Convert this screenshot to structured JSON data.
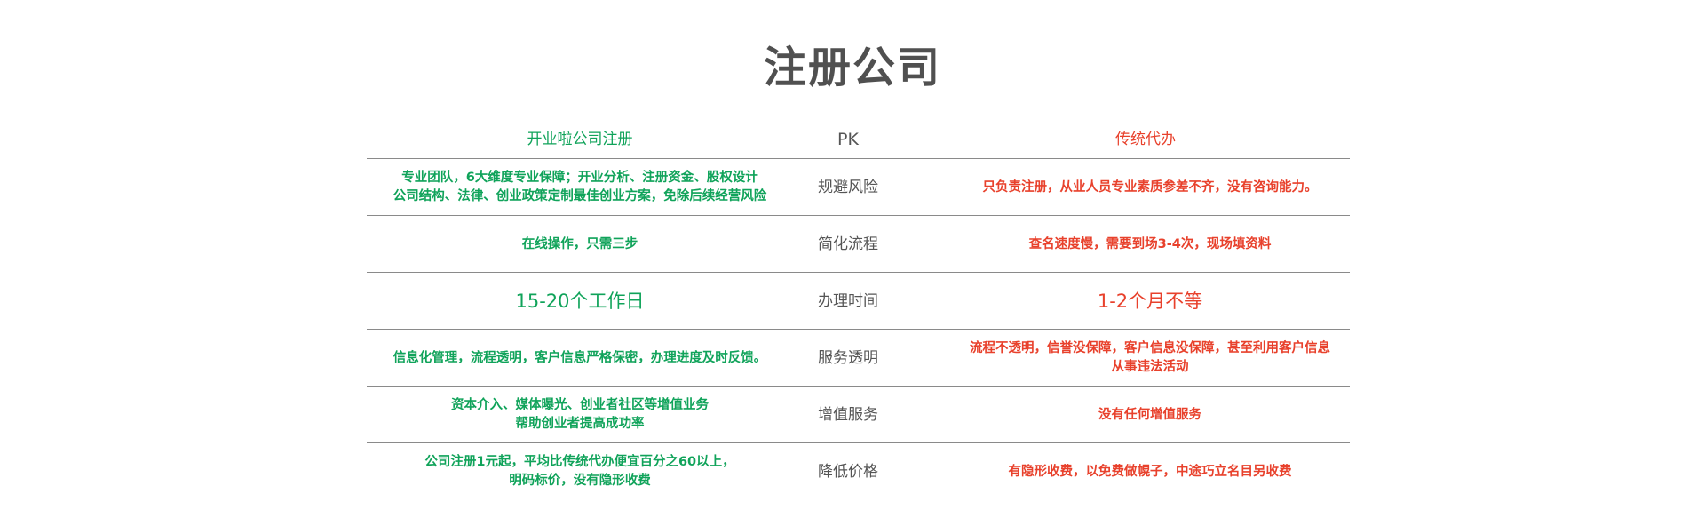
{
  "title": "注册公司",
  "header": {
    "left": "开业啦公司注册",
    "mid": "PK",
    "right": "传统代办"
  },
  "rows": [
    {
      "left": "专业团队，6大维度专业保障；开业分析、注册资金、股权设计\n公司结构、法律、创业政策定制最佳创业方案，免除后续经营风险",
      "mid": "规避风险",
      "right": "只负责注册，从业人员专业素质参差不齐，没有咨询能力。"
    },
    {
      "left": "在线操作，只需三步",
      "mid": "简化流程",
      "right": "查名速度慢，需要到场3-4次，现场填资料"
    },
    {
      "left": "15-20个工作日",
      "mid": "办理时间",
      "right": "1-2个月不等"
    },
    {
      "left": "信息化管理，流程透明，客户信息严格保密，办理进度及时反馈。",
      "mid": "服务透明",
      "right": "流程不透明，信誉没保障，客户信息没保障，甚至利用客户信息\n从事违法活动"
    },
    {
      "left": "资本介入、媒体曝光、创业者社区等增值业务\n帮助创业者提高成功率",
      "mid": "增值服务",
      "right": "没有任何增值服务"
    },
    {
      "left": "公司注册1元起，平均比传统代办便宜百分之60以上，\n明码标价，没有隐形收费",
      "mid": "降低价格",
      "right": "有隐形收费，以免费做幌子，中途巧立名目另收费"
    }
  ]
}
